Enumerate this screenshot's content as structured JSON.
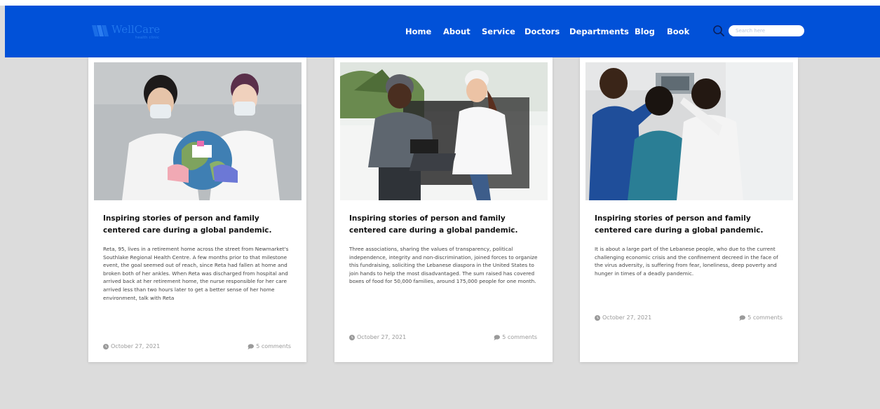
{
  "brand": {
    "name": "WellCare",
    "tagline": "health clinic",
    "accent_color": "#0151d8"
  },
  "nav": {
    "items": [
      {
        "label": "Home"
      },
      {
        "label": "About"
      },
      {
        "label": "Service"
      },
      {
        "label": "Doctors"
      },
      {
        "label": "Departments"
      },
      {
        "label": "Blog"
      },
      {
        "label": "Book"
      }
    ]
  },
  "search": {
    "icon": "search-icon",
    "placeholder": "Search here"
  },
  "posts": [
    {
      "image": "two masked women holding a globe with a pandemic note",
      "title": "Inspiring stories of person and family centered care during a global pandemic.",
      "body": "Reta, 95, lives in a retirement home across the street from Newmarket's Southlake Regional Health Centre. A few months prior to that milestone event, the goal seemed out of reach, since Reta had fallen at home and broken both of her ankles. When Reta was discharged from hospital and arrived back at her retirement home, the nurse responsible for her care arrived less than two hours later to get a better sense of her home environment, talk with Reta",
      "date": "October 27, 2021",
      "comments": "5 comments"
    },
    {
      "image": "doctor and nurse talking at a table with a laptop",
      "title": "Inspiring stories of person and family centered care during a global pandemic.",
      "body": "Three associations, sharing the values of transparency, political independence, integrity and non-discrimination, joined forces to organize this fundraising, soliciting the Lebanese diaspora in the United States to join hands to help the most disadvantaged. The sum raised has covered boxes of food for 50,000 families, around 175,000 people for one month.",
      "date": "October 27, 2021",
      "comments": "5 comments"
    },
    {
      "image": "three medical staff looking at x-ray scans",
      "title": "Inspiring stories of person and family centered care during a global pandemic.",
      "body": "It is about a large part of the Lebanese people, who due to the current challenging economic crisis and the confinement decreed in the face of the virus adversity, is suffering from fear, loneliness, deep poverty and hunger in times of a deadly pandemic.",
      "date": "October 27, 2021",
      "comments": "5 comments"
    }
  ]
}
